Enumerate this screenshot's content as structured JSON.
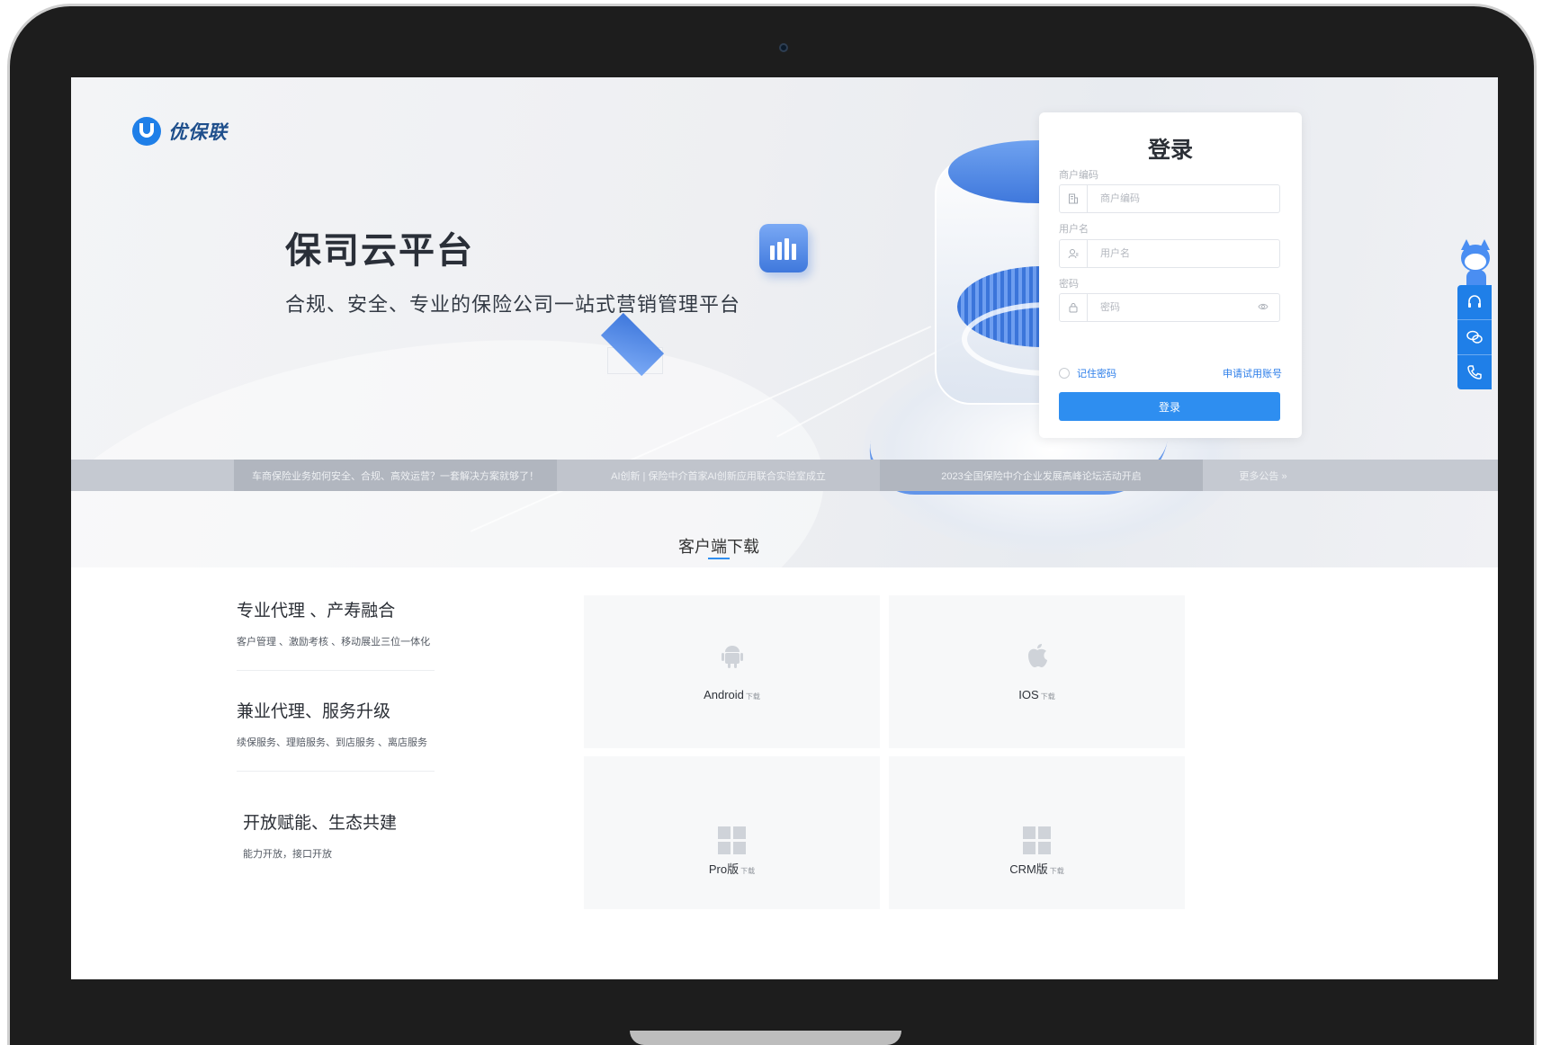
{
  "brand": {
    "logo_text": "优保联"
  },
  "hero": {
    "title": "保司云平台",
    "subtitle": "合规、安全、专业的保险公司一站式营销管理平台"
  },
  "login": {
    "title": "登录",
    "merchant_label": "商户编码",
    "merchant_placeholder": "商户编码",
    "username_label": "用户名",
    "username_placeholder": "用户名",
    "password_label": "密码",
    "password_placeholder": "密码",
    "remember_label": "记住密码",
    "apply_link": "申请试用账号",
    "submit_label": "登录"
  },
  "news": {
    "items": [
      "车商保险业务如何安全、合规、高效运营？一套解决方案就够了！",
      "AI创新 | 保险中介首家AI创新应用联合实验室成立",
      "2023全国保险中介企业发展高峰论坛活动开启"
    ],
    "more": "更多公告 »"
  },
  "download": {
    "title": "客户端下载",
    "features": [
      {
        "title": "专业代理 、产寿融合",
        "desc": "客户管理 、激励考核 、移动展业三位一体化"
      },
      {
        "title": "兼业代理、服务升级",
        "desc": "续保服务、理赔服务、到店服务 、离店服务"
      },
      {
        "title": "开放赋能、生态共建",
        "desc": "能力开放，接口开放"
      }
    ],
    "cards": [
      {
        "name": "Android",
        "suffix": "下载",
        "icon": "android-icon"
      },
      {
        "name": "IOS",
        "suffix": "下载",
        "icon": "apple-icon"
      },
      {
        "name": "Pro版",
        "suffix": "下载",
        "icon": "windows-icon"
      },
      {
        "name": "CRM版",
        "suffix": "下载",
        "icon": "windows-icon"
      }
    ]
  },
  "side_widget": {
    "icons": [
      "headset-icon",
      "chat-icon",
      "phone-icon"
    ]
  },
  "colors": {
    "primary": "#2e8ef0",
    "brand_blue": "#1f7fe8",
    "ticker_bg": "#c5c9d1"
  }
}
